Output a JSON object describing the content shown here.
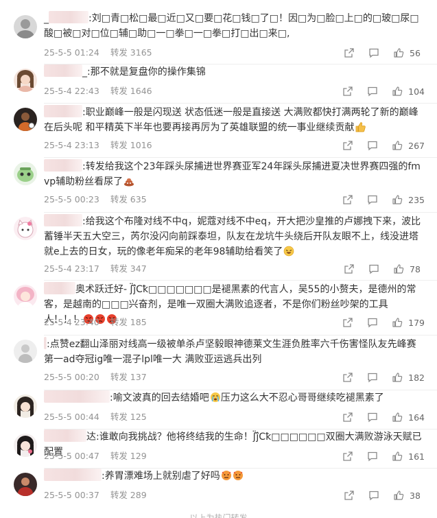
{
  "comments": [
    {
      "text": ":刘□青□松□最□近□又□要□花□钱□了□！因□为□脸□上□的□玻□尿□酸□被□对□位□辅□助□一□拳□一□拳□打□出□来□,",
      "time": "25-5-5 01:24",
      "repost": "转发 3165",
      "likes": "56",
      "avatar": "gray-portrait",
      "emojis": []
    },
    {
      "text": ":那不就是复盘你的操作集锦",
      "time": "25-5-4 22:43",
      "repost": "转发 1646",
      "likes": "104",
      "avatar": "girl-brown-hair",
      "emojis": []
    },
    {
      "text": ":职业巅峰一般是闪现送 状态低迷一般是直接送 大满败都快打满两轮了新的巅峰在后头呢 和平精英下半年也要再接再厉为了英雄联盟的统一事业继续贡献",
      "time": "25-5-4 23:13",
      "repost": "转发 1016",
      "likes": "267",
      "avatar": "dark-figure",
      "emojis": [
        "thumbs-up-emoji"
      ]
    },
    {
      "text": ":转发给我这个23年踩头尿捕进世界赛亚军24年踩头尿捕进夏决世界赛四强的fmvp辅助粉丝看尿了",
      "time": "25-5-5 00:23",
      "repost": "转发 635",
      "likes": "235",
      "avatar": "green-cartoon",
      "emojis": [
        "poop-emoji"
      ]
    },
    {
      "text": ":给我这个布隆对线不中q，妮蔻对线不中eq，开大把沙皇推的卢娜拽下来，波比蓄锤半天五大空三，芮尔没闪向前踩泰坦，队友在龙坑牛头绕后开队友眼不上，线没进塔就e上去的日女，玩的像老年痴呆的老年98辅助给看笑了",
      "time": "25-5-4 23:17",
      "repost": "转发 347",
      "likes": "78",
      "avatar": "pink-cat",
      "emojis": [
        "laughing-emoji"
      ]
    },
    {
      "text": "奥术跃迁好- ʃ̈ĵ̈Cꝁ□□□□□□□是褪黑素的代言人，吴55的小赘夫，是德州的常客，是越南的□□□兴奋剂，是唯一双圈大满败追逐者，不是你们粉丝吵架的工具人！！！",
      "time": "25-5-4 23:40",
      "repost": "转发 185",
      "likes": "179",
      "avatar": "anime-pink",
      "emojis": [
        "angry-emoji",
        "angry-emoji",
        "angry-emoji"
      ]
    },
    {
      "text": ":点赞ez翻山泽丽对线高一级被单杀卢坚毅眼神德莱文生涯负胜率六千伤害怪队友先峰赛第一ad夺冠ig唯一混子lpl唯一大 满败亚运逃兵出列",
      "time": "25-5-5 00:20",
      "repost": "转发 137",
      "likes": "182",
      "avatar": "white-figure",
      "emojis": []
    },
    {
      "text": ":喻文波真的回去结婚吧",
      "text2": "压力这么大不忍心哥哥继续吃褪黑素了",
      "time": "25-5-5 00:44",
      "repost": "转发 125",
      "likes": "164",
      "avatar": "anime-dark",
      "emojis": [
        "crying-emoji"
      ]
    },
    {
      "text": "达:谁敢向我挑战？他将终结我的生命！ʃ̈ĵ̈Cꝁ□□□□□□双圈大满败游泳天赋已配置",
      "time": "25-5-5 00:47",
      "repost": "转发 129",
      "likes": "161",
      "avatar": "girl-dark-hair",
      "emojis": []
    },
    {
      "text": ":养胃漂难场上就别虐了好吗",
      "time": "25-5-5 00:37",
      "repost": "转发 289",
      "likes": "38",
      "avatar": "red-figure",
      "emojis": [
        "hot-face-emoji",
        "hot-face-emoji"
      ]
    }
  ],
  "footer_hint": "以上为热门转发",
  "colors": {
    "meta": "#939393",
    "text": "#333333",
    "divider": "#eeeeee",
    "blur": "#f3dede"
  },
  "icons": {
    "repost": "share-arrow-icon",
    "comment": "comment-icon",
    "like": "thumbs-up-icon"
  }
}
